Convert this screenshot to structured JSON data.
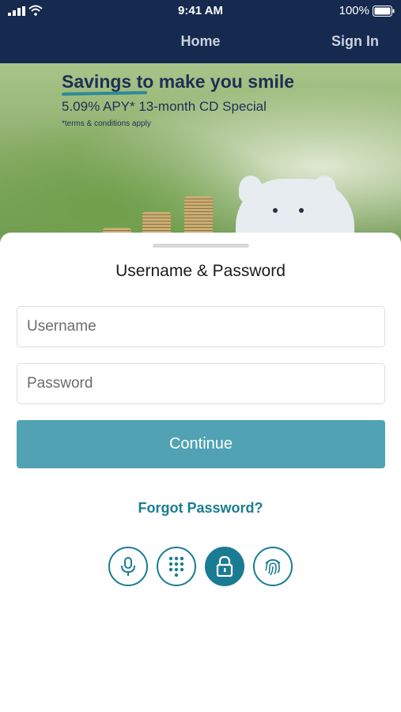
{
  "status_bar": {
    "time": "9:41 AM",
    "battery_pct": "100%"
  },
  "nav": {
    "home": "Home",
    "sign_in": "Sign In"
  },
  "banner": {
    "title_emphasis": "Savings",
    "title_rest": " to make you smile",
    "subtitle": "5.09% APY* 13-month CD Special",
    "terms": "*terms & conditions apply"
  },
  "sheet": {
    "title": "Username & Password",
    "username_placeholder": "Username",
    "password_placeholder": "Password",
    "continue_label": "Continue",
    "forgot_label": "Forgot Password?"
  },
  "auth_methods": [
    {
      "icon": "microphone-icon",
      "active": false
    },
    {
      "icon": "keypad-icon",
      "active": false
    },
    {
      "icon": "lock-icon",
      "active": true
    },
    {
      "icon": "fingerprint-icon",
      "active": false
    }
  ],
  "colors": {
    "header_bg": "#16294f",
    "accent": "#1a7c92",
    "button": "#51a3b3"
  }
}
